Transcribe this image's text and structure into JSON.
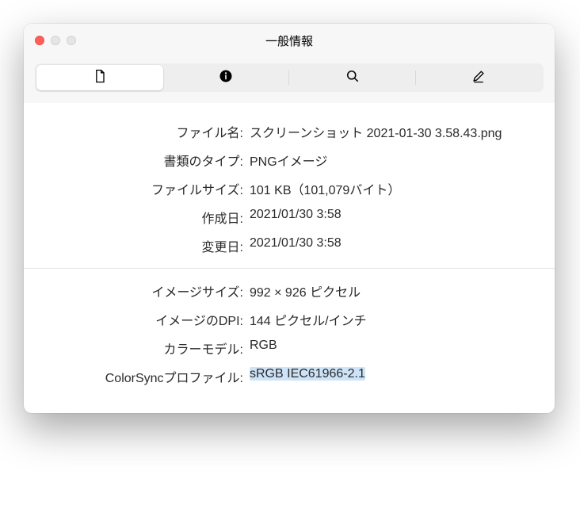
{
  "window": {
    "title": "一般情報"
  },
  "tabs": {
    "file": "file-icon",
    "info": "info-icon",
    "search": "search-icon",
    "edit": "edit-icon"
  },
  "info": {
    "filename_label": "ファイル名:",
    "filename_value": "スクリーンショット 2021-01-30 3.58.43.png",
    "doctype_label": "書類のタイプ:",
    "doctype_value": "PNGイメージ",
    "filesize_label": "ファイルサイズ:",
    "filesize_value": "101 KB（101,079バイト）",
    "created_label": "作成日:",
    "created_value": "2021/01/30 3:58",
    "modified_label": "変更日:",
    "modified_value": "2021/01/30 3:58",
    "imagesize_label": "イメージサイズ:",
    "imagesize_value": "992 × 926 ピクセル",
    "dpi_label": "イメージのDPI:",
    "dpi_value": "144 ピクセル/インチ",
    "colormodel_label": "カラーモデル:",
    "colormodel_value": "RGB",
    "colorsync_label": "ColorSyncプロファイル:",
    "colorsync_value": "sRGB IEC61966-2.1"
  }
}
